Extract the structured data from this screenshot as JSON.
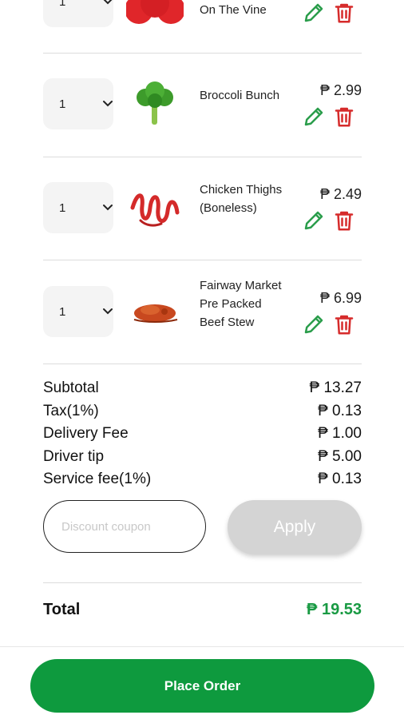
{
  "items": [
    {
      "qty": "1",
      "name": "On The Vine",
      "price": "",
      "image": "tomatoes-icon"
    },
    {
      "qty": "1",
      "name": "Broccoli Bunch",
      "price": "₱ 2.99",
      "image": "broccoli-icon"
    },
    {
      "qty": "1",
      "name": "Chicken Thighs (Boneless)",
      "price": "₱ 2.49",
      "image": "chicken-thighs-icon"
    },
    {
      "qty": "1",
      "name": "Fairway Market Pre Packed Beef Stew",
      "price": "₱ 6.99",
      "image": "beef-stew-icon"
    }
  ],
  "summary": [
    {
      "label": "Subtotal",
      "value": "₱ 13.27"
    },
    {
      "label": "Tax(1%)",
      "value": "₱ 0.13"
    },
    {
      "label": "Delivery Fee",
      "value": "₱ 1.00"
    },
    {
      "label": "Driver tip",
      "value": "₱ 5.00"
    },
    {
      "label": "Service fee(1%)",
      "value": "₱ 0.13"
    }
  ],
  "coupon": {
    "placeholder": "Discount coupon"
  },
  "apply_label": "Apply",
  "total": {
    "label": "Total",
    "value": "₱ 19.53"
  },
  "place_order_label": "Place Order",
  "colors": {
    "accent": "#0e9a3e",
    "total": "#199a43",
    "edit": "#2a9d4b",
    "delete": "#d62b2b"
  }
}
